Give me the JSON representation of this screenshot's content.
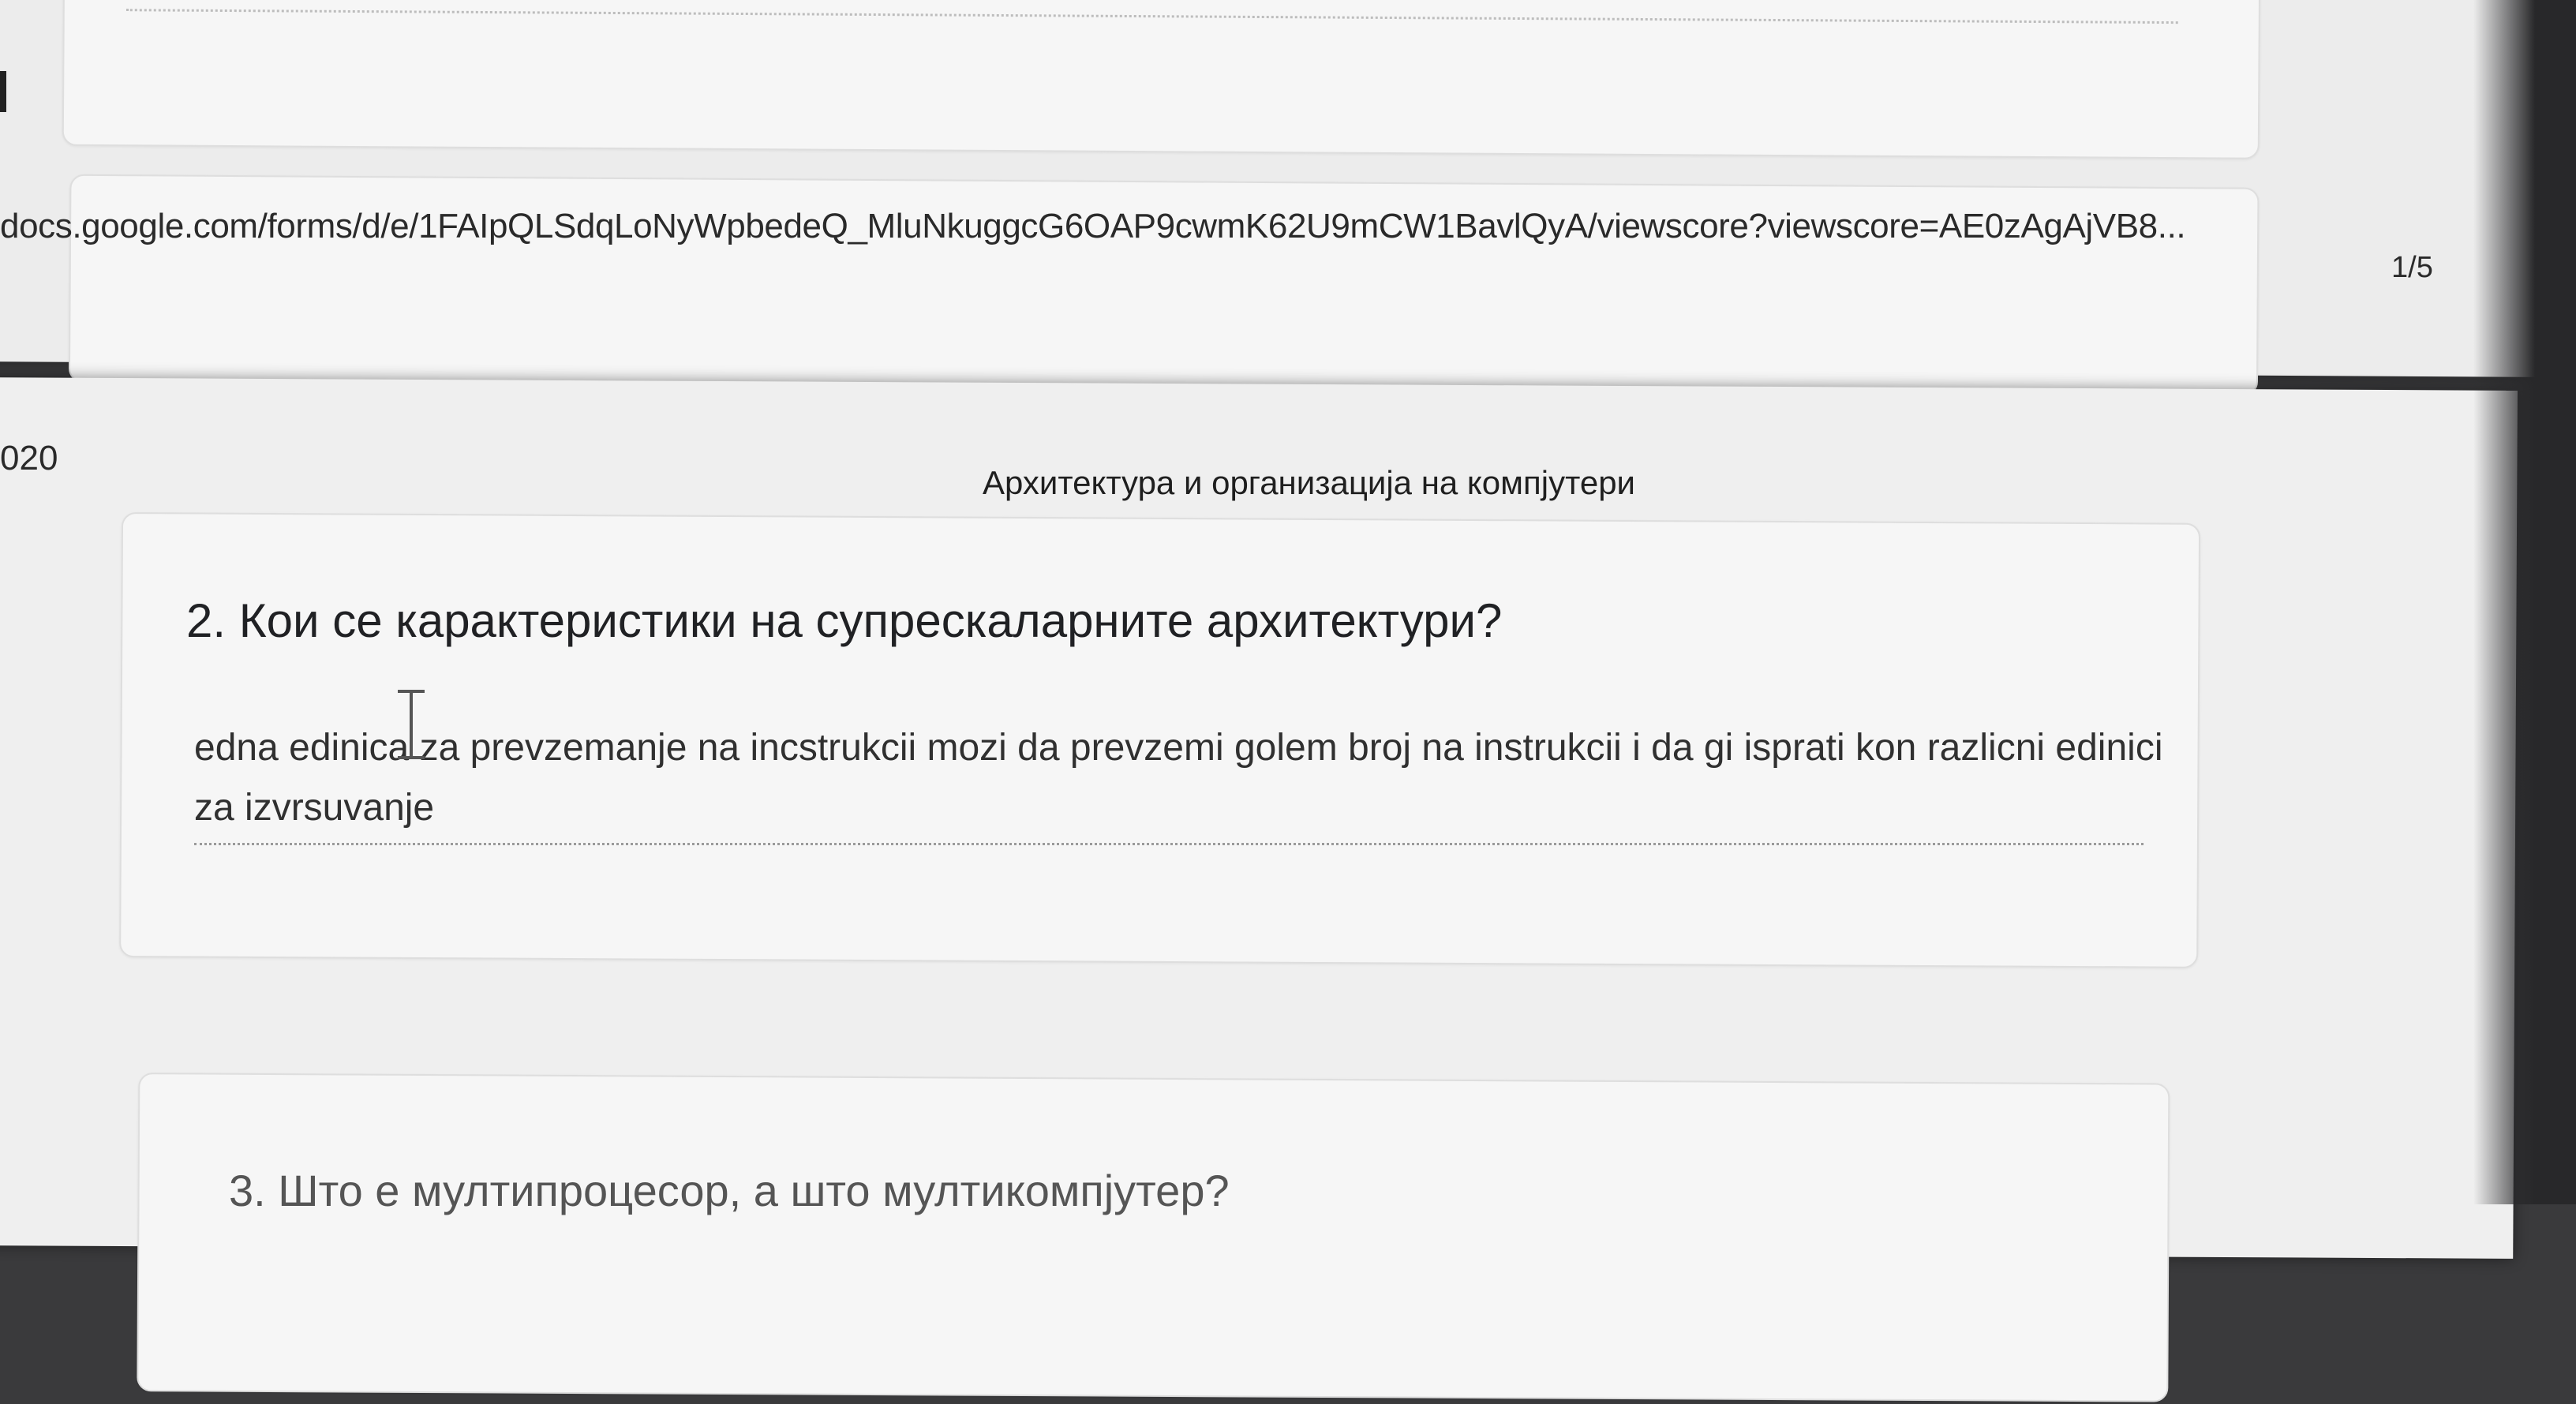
{
  "print_header": {
    "url": "docs.google.com/forms/d/e/1FAIpQLSdqLoNyWpbedeQ_MluNkuggcG6OAP9cwmK62U9mCW1BavlQyA/viewscore?viewscore=AE0zAgAjVB8...",
    "page_number": "1/5"
  },
  "page2_header": {
    "date_fragment": "020",
    "title": "Архитектура и организација на компјутери"
  },
  "question2": {
    "title": "2. Кои се карактеристики на супрескаларните архитектури?",
    "answer": "edna edinica za prevzemanje na incstrukcii mozi da prevzemi golem broj na instrukcii i da gi ispratі kon razlicni edinici za izvrsuvanje"
  },
  "question3": {
    "title": "3. Што е мултипроцесор, а што мултикомпјутер?"
  },
  "icons": [
    "text-cursor-icon"
  ],
  "colors": {
    "paper": "#efefef",
    "background": "#3a3a3c",
    "text": "#202124"
  }
}
